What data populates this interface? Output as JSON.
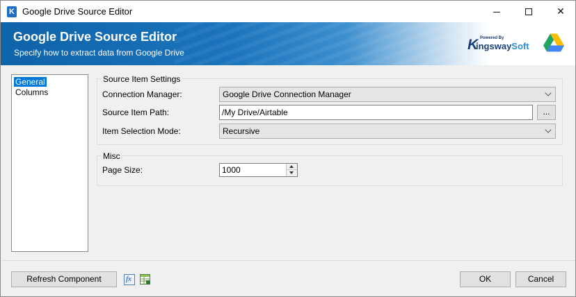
{
  "window": {
    "title": "Google Drive Source Editor",
    "icon_letter": "K",
    "minimize_icon": "minimize-icon",
    "maximize_icon": "maximize-icon",
    "close_glyph": "✕"
  },
  "banner": {
    "title": "Google Drive Source Editor",
    "subtitle": "Specify how to extract data from Google Drive",
    "powered_by": "Powered By",
    "brand_k": "K",
    "brand_main": "ingsway",
    "brand_soft": "Soft"
  },
  "nav": {
    "items": [
      {
        "label": "General",
        "selected": true
      },
      {
        "label": "Columns",
        "selected": false
      }
    ]
  },
  "source_settings": {
    "group_title": "Source Item Settings",
    "connection_manager_label": "Connection Manager:",
    "connection_manager_value": "Google Drive Connection Manager",
    "source_item_path_label": "Source Item Path:",
    "source_item_path_value": "/My Drive/Airtable",
    "browse_label": "...",
    "item_selection_mode_label": "Item Selection Mode:",
    "item_selection_mode_value": "Recursive"
  },
  "misc": {
    "group_title": "Misc",
    "page_size_label": "Page Size:",
    "page_size_value": "1000"
  },
  "footer": {
    "refresh_label": "Refresh Component",
    "ok_label": "OK",
    "cancel_label": "Cancel",
    "fx_glyph": "fx"
  },
  "colors": {
    "accent": "#0078d7",
    "banner_blue": "#1b74bc",
    "brand_navy": "#1a3f7a"
  }
}
